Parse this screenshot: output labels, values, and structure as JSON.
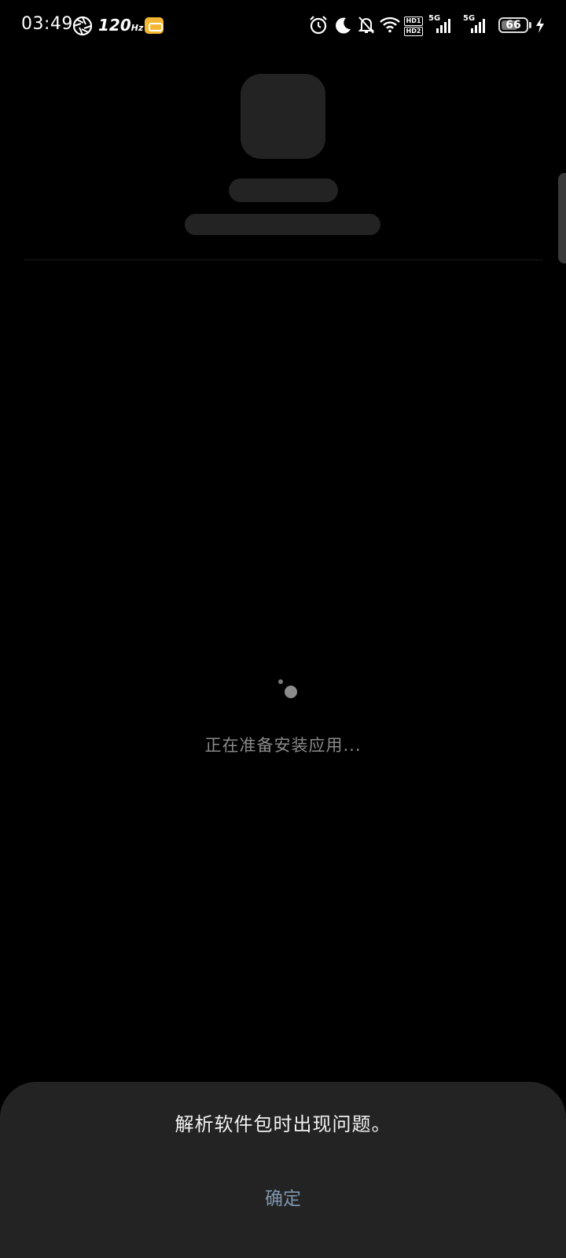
{
  "status_bar": {
    "time": "03:49",
    "refresh_rate": "120",
    "refresh_unit": "Hz",
    "hd_top": "HD1",
    "hd_bottom": "HD2",
    "sim1_label": "5G",
    "sim2_label": "5G",
    "battery_level": "66",
    "battery_fraction": 0.66,
    "icons": [
      "aperture-icon",
      "game-mode-icon",
      "alarm-icon",
      "moon-icon",
      "bell-off-icon",
      "wifi-icon",
      "hd-voice-icon",
      "signal-icon",
      "battery-icon",
      "charging-icon"
    ]
  },
  "loading": {
    "text": "正在准备安装应用..."
  },
  "dialog": {
    "message": "解析软件包时出现问题。",
    "confirm_label": "确定"
  },
  "colors": {
    "background": "#000000",
    "placeholder": "#232323",
    "dialog_bg": "#232323",
    "confirm_text": "#7d95ac",
    "loading_text": "#8a8a8a"
  }
}
